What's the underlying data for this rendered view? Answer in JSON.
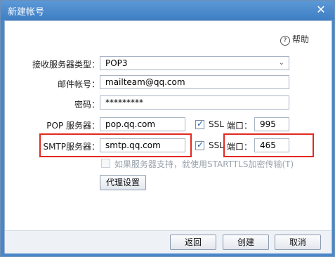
{
  "window": {
    "title": "新建帐号",
    "close_glyph": "✕"
  },
  "help": {
    "icon_glyph": "?",
    "label": "帮助"
  },
  "form": {
    "incoming_type_label": "接收服务器类型：",
    "incoming_type_value": "POP3",
    "account_label": "邮件帐号：",
    "account_value": "mailteam@qq.com",
    "password_label": "密码：",
    "password_value": "*********",
    "pop_label": "POP 服务器：",
    "pop_value": "pop.qq.com",
    "pop_ssl_label": "SSL",
    "pop_port_label": "端口：",
    "pop_port_value": "995",
    "smtp_label": "SMTP服务器：",
    "smtp_value": "smtp.qq.com",
    "smtp_ssl_label": "SSL",
    "smtp_port_label": "端口：",
    "smtp_port_value": "465",
    "starttls_label": "如果服务器支持，就使用STARTTLS加密传输(T)",
    "proxy_button": "代理设置"
  },
  "footer": {
    "back_button": "返回",
    "create_button": "创建",
    "cancel_button": "取消"
  },
  "colors": {
    "highlight": "#e2281f",
    "titlebar": "#4a86c8"
  }
}
